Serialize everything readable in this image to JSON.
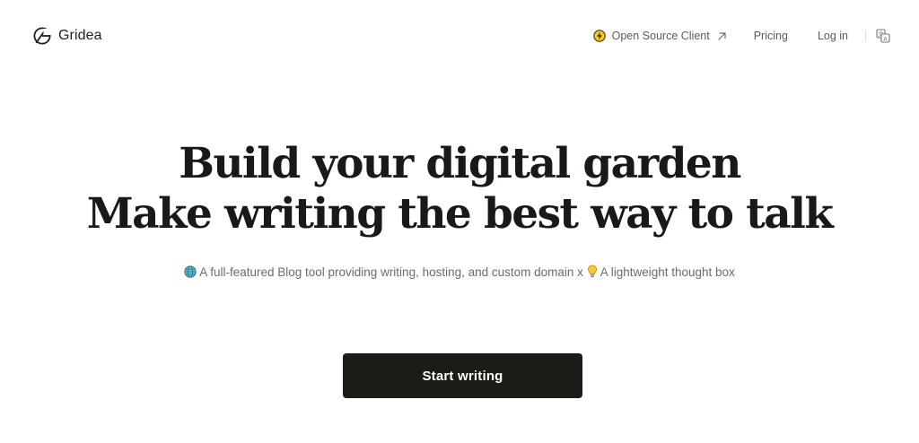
{
  "brand": {
    "name": "Gridea",
    "logo_icon": "gridea-logo-icon"
  },
  "nav": {
    "open_source_label": "Open Source Client",
    "open_source_icon": "lightning-badge-icon",
    "external_icon": "arrow-up-right-icon",
    "pricing_label": "Pricing",
    "login_label": "Log in",
    "language_icon": "translate-icon"
  },
  "hero": {
    "title_line1": "Build your digital garden",
    "title_line2": "Make writing the best way to talk",
    "subtitle_part1": " A full-featured Blog tool providing writing, hosting, and custom domain x ",
    "subtitle_part2": " A lightweight thought box",
    "subtitle_icon1": "globe-icon",
    "subtitle_icon2": "lightbulb-icon"
  },
  "cta": {
    "label": "Start writing"
  },
  "colors": {
    "primary_dark": "#1c1b18",
    "text_muted": "#6b6b6b",
    "nav_text": "#5b5b5b",
    "badge_yellow": "#f5c518"
  }
}
